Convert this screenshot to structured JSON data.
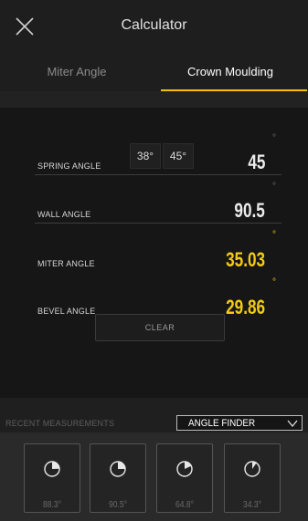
{
  "header": {
    "title": "Calculator",
    "close_icon": "close-icon"
  },
  "tabs": [
    {
      "label": "Miter Angle",
      "active": false
    },
    {
      "label": "Crown Moulding",
      "active": true
    }
  ],
  "accent_color": "#f2cc14",
  "fields": {
    "spring": {
      "label": "SPRING ANGLE",
      "value": "45",
      "unit": "°",
      "presets": [
        "38°",
        "45°"
      ]
    },
    "wall": {
      "label": "WALL ANGLE",
      "value": "90.5",
      "unit": "°"
    },
    "miter": {
      "label": "MITER ANGLE",
      "value": "35.03",
      "unit": "°"
    },
    "bevel": {
      "label": "BEVEL ANGLE",
      "value": "29.86",
      "unit": "°"
    }
  },
  "clear_label": "CLEAR",
  "recent": {
    "label": "RECENT MEASUREMENTS",
    "dropdown_value": "ANGLE FINDER",
    "items": [
      {
        "value": "88.3°",
        "icon": "angle-dial-icon",
        "fraction": 0.245
      },
      {
        "value": "90.5°",
        "icon": "angle-dial-icon",
        "fraction": 0.251
      },
      {
        "value": "64.8°",
        "icon": "angle-dial-icon",
        "fraction": 0.18
      },
      {
        "value": "34.3°",
        "icon": "angle-dial-icon",
        "fraction": 0.095
      }
    ]
  }
}
